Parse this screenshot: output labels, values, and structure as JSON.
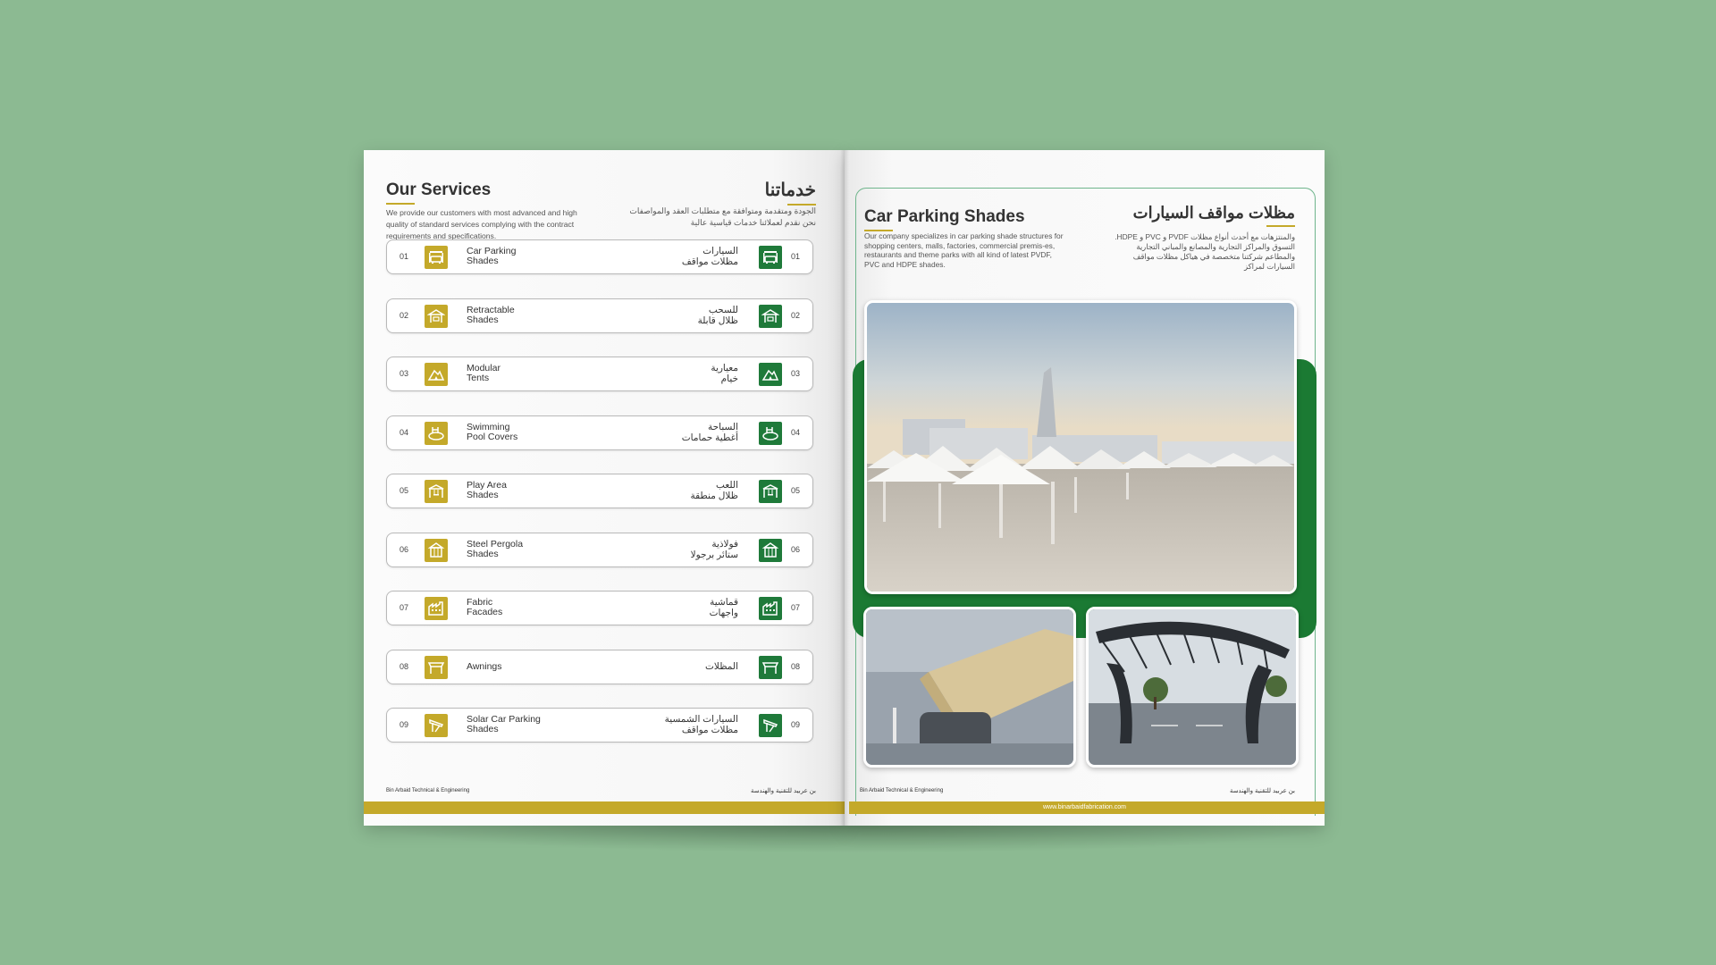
{
  "left_page": {
    "title_en": "Our Services",
    "title_ar": "خدماتنا",
    "desc_en": "We provide our customers with most advanced and high quality of standard services complying with the contract requirements and specifications.",
    "desc_ar": "الجودة ومتقدمة ومتوافقة مع متطلبات العقد والمواصفات نحن نقدم لعملائنا خدمات قياسية عالية",
    "services": [
      {
        "num": "01",
        "en": "Car Parking\nShades",
        "ar": "السيارات\nمظلات مواقف",
        "icon": "car-icon"
      },
      {
        "num": "02",
        "en": "Retractable\nShades",
        "ar": "للسحب\nظلال قابلة",
        "icon": "retractable-shade-icon"
      },
      {
        "num": "03",
        "en": "Modular\nTents",
        "ar": "معيارية\nخيام",
        "icon": "tent-icon"
      },
      {
        "num": "04",
        "en": "Swimming\nPool Covers",
        "ar": "السباحة\nأغطية حمامات",
        "icon": "pool-icon"
      },
      {
        "num": "05",
        "en": "Play Area\nShades",
        "ar": "اللعب\nظلال منطقة",
        "icon": "playground-icon"
      },
      {
        "num": "06",
        "en": "Steel Pergola\nShades",
        "ar": "فولاذية\nستائر برجولا",
        "icon": "pergola-icon"
      },
      {
        "num": "07",
        "en": "Fabric\nFacades",
        "ar": "قماشية\nواجهات",
        "icon": "facade-icon"
      },
      {
        "num": "08",
        "en": "Awnings",
        "ar": "المظلات",
        "icon": "awning-icon"
      },
      {
        "num": "09",
        "en": "Solar Car Parking\nShades",
        "ar": "السيارات الشمسية\nمظلات مواقف",
        "icon": "solar-shade-icon"
      }
    ],
    "footer_en": "Bin Arbaid Technical & Engineering",
    "footer_ar": "بن عربيد للتقنية والهندسة"
  },
  "right_page": {
    "title_en": "Car Parking Shades",
    "title_ar": "مظلات مواقف السيارات",
    "desc_en": "Our company specializes in car parking shade structures for shopping centers, malls, factories, commercial premis-es, restaurants and theme parks with all kind of latest PVDF, PVC and HDPE shades.",
    "desc_ar": "والمنتزهات مع أحدث أنواع مظلات PVDF و PVC و HDPE. التسوق والمراكز التجارية والمصانع والمباني التجارية والمطاعم شركتنا متخصصة في هياكل مظلات مواقف السيارات لمراكز",
    "footer_en": "Bin Arbaid Technical & Engineering",
    "footer_ar": "بن عربيد للتقنية والهندسة",
    "url": "www.binarbaidfabrication.com"
  },
  "colors": {
    "background": "#8cba92",
    "gold": "#c4a92a",
    "green": "#1b7a33"
  }
}
